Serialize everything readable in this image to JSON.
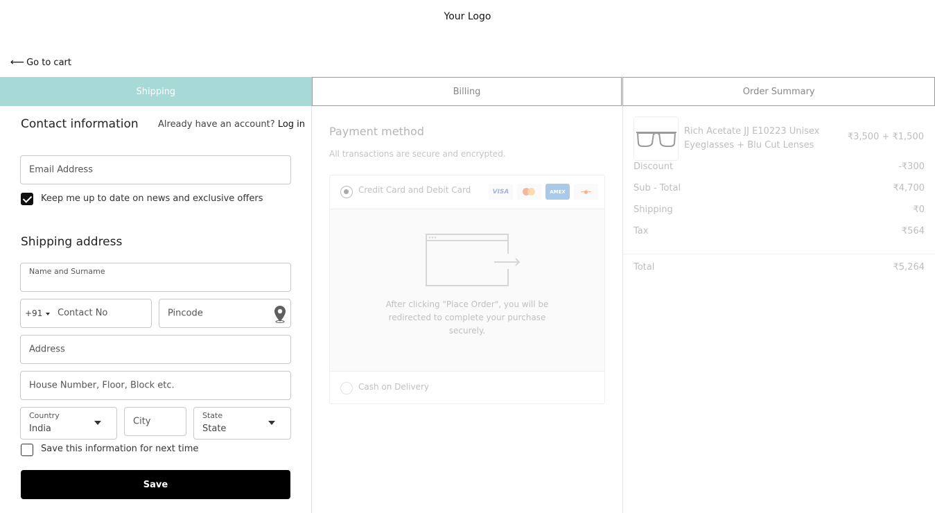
{
  "header": {
    "logo": "Your Logo",
    "back_label": "Go to cart"
  },
  "tabs": [
    {
      "label": "Shipping",
      "active": true
    },
    {
      "label": "Billing",
      "active": false
    },
    {
      "label": "Order Summary",
      "active": false
    }
  ],
  "contact": {
    "title": "Contact information",
    "account_prompt": "Already have an account?",
    "login_label": "Log in",
    "email_placeholder": "Email Address",
    "newsletter_label": "Keep me up to date on news and exclusive offers",
    "newsletter_checked": true
  },
  "shipping": {
    "title": "Shipping address",
    "name_label": "Name and Surname",
    "country_code": "+91",
    "contact_placeholder": "Contact No",
    "pincode_placeholder": "Pincode",
    "address_placeholder": "Address",
    "house_placeholder": "House Number, Floor, Block etc.",
    "country_label": "Country",
    "country_value": "India",
    "city_placeholder": "City",
    "state_label": "State",
    "state_value": "State",
    "save_info_label": "Save this information for next time",
    "save_info_checked": false,
    "save_button": "Save"
  },
  "payment": {
    "title": "Payment method",
    "secure_note": "All transactions are secure and encrypted.",
    "card_option": "Credit Card and Debit Card",
    "card_brands": [
      "VISA",
      "mastercard",
      "AMEX",
      "discover"
    ],
    "redirect_text": "After clicking \"Place Order\", you will be redirected to complete your purchase securely.",
    "cod_option": "Cash on Delivery"
  },
  "summary": {
    "product_name": "Rich Acetate JJ E10223 Unisex Eyeglasses + Blu Cut Lenses",
    "product_price": "₹3,500 + ₹1,500",
    "rows": [
      {
        "label": "Discount",
        "value": "-₹300"
      },
      {
        "label": "Sub - Total",
        "value": "₹4,700"
      },
      {
        "label": "Shipping",
        "value": "₹0"
      },
      {
        "label": "Tax",
        "value": "₹564"
      }
    ],
    "total_label": "Total",
    "total_value": "₹5,264"
  },
  "colors": {
    "accent": "#a7dad7",
    "button": "#000000",
    "muted": "#c0c0c0"
  }
}
